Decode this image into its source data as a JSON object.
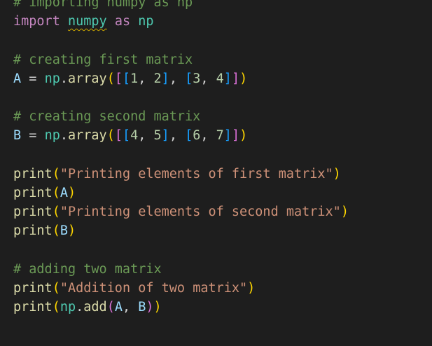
{
  "editor": {
    "language": "python",
    "colors": {
      "background": "#1e1e1e",
      "comment": "#6a9955",
      "keyword": "#c586c0",
      "module": "#4ec9b0",
      "variable": "#9cdcfe",
      "function": "#dcdcaa",
      "number": "#b5cea8",
      "string": "#ce9178",
      "bracket_level_1": "#ffd700",
      "bracket_level_2": "#da70d6",
      "bracket_level_3": "#179fff",
      "warning_squiggle": "#cca700"
    },
    "lines": [
      [
        {
          "t": "comment",
          "v": "# importing numpy as np"
        }
      ],
      [
        {
          "t": "keyword",
          "v": "import"
        },
        {
          "t": "op",
          "v": " "
        },
        {
          "t": "module",
          "v": "numpy",
          "squiggle": true
        },
        {
          "t": "op",
          "v": " "
        },
        {
          "t": "keyword",
          "v": "as"
        },
        {
          "t": "op",
          "v": " "
        },
        {
          "t": "module",
          "v": "np"
        }
      ],
      [],
      [
        {
          "t": "comment",
          "v": "# creating first matrix"
        }
      ],
      [
        {
          "t": "var",
          "v": "A"
        },
        {
          "t": "op",
          "v": " = "
        },
        {
          "t": "module",
          "v": "np"
        },
        {
          "t": "op",
          "v": "."
        },
        {
          "t": "func",
          "v": "array"
        },
        {
          "t": "br1",
          "v": "("
        },
        {
          "t": "br2",
          "v": "["
        },
        {
          "t": "br3",
          "v": "["
        },
        {
          "t": "number",
          "v": "1"
        },
        {
          "t": "op",
          "v": ", "
        },
        {
          "t": "number",
          "v": "2"
        },
        {
          "t": "br3",
          "v": "]"
        },
        {
          "t": "op",
          "v": ", "
        },
        {
          "t": "br3",
          "v": "["
        },
        {
          "t": "number",
          "v": "3"
        },
        {
          "t": "op",
          "v": ", "
        },
        {
          "t": "number",
          "v": "4"
        },
        {
          "t": "br3",
          "v": "]"
        },
        {
          "t": "br2",
          "v": "]"
        },
        {
          "t": "br1",
          "v": ")"
        }
      ],
      [],
      [
        {
          "t": "comment",
          "v": "# creating second matrix"
        }
      ],
      [
        {
          "t": "var",
          "v": "B"
        },
        {
          "t": "op",
          "v": " = "
        },
        {
          "t": "module",
          "v": "np"
        },
        {
          "t": "op",
          "v": "."
        },
        {
          "t": "func",
          "v": "array"
        },
        {
          "t": "br1",
          "v": "("
        },
        {
          "t": "br2",
          "v": "["
        },
        {
          "t": "br3",
          "v": "["
        },
        {
          "t": "number",
          "v": "4"
        },
        {
          "t": "op",
          "v": ", "
        },
        {
          "t": "number",
          "v": "5"
        },
        {
          "t": "br3",
          "v": "]"
        },
        {
          "t": "op",
          "v": ", "
        },
        {
          "t": "br3",
          "v": "["
        },
        {
          "t": "number",
          "v": "6"
        },
        {
          "t": "op",
          "v": ", "
        },
        {
          "t": "number",
          "v": "7"
        },
        {
          "t": "br3",
          "v": "]"
        },
        {
          "t": "br2",
          "v": "]"
        },
        {
          "t": "br1",
          "v": ")"
        }
      ],
      [],
      [
        {
          "t": "func",
          "v": "print"
        },
        {
          "t": "br1",
          "v": "("
        },
        {
          "t": "string",
          "v": "\"Printing elements of first matrix\""
        },
        {
          "t": "br1",
          "v": ")"
        }
      ],
      [
        {
          "t": "func",
          "v": "print"
        },
        {
          "t": "br1",
          "v": "("
        },
        {
          "t": "var",
          "v": "A"
        },
        {
          "t": "br1",
          "v": ")"
        }
      ],
      [
        {
          "t": "func",
          "v": "print"
        },
        {
          "t": "br1",
          "v": "("
        },
        {
          "t": "string",
          "v": "\"Printing elements of second matrix\""
        },
        {
          "t": "br1",
          "v": ")"
        }
      ],
      [
        {
          "t": "func",
          "v": "print"
        },
        {
          "t": "br1",
          "v": "("
        },
        {
          "t": "var",
          "v": "B"
        },
        {
          "t": "br1",
          "v": ")"
        }
      ],
      [],
      [
        {
          "t": "comment",
          "v": "# adding two matrix"
        }
      ],
      [
        {
          "t": "func",
          "v": "print"
        },
        {
          "t": "br1",
          "v": "("
        },
        {
          "t": "string",
          "v": "\"Addition of two matrix\""
        },
        {
          "t": "br1",
          "v": ")"
        }
      ],
      [
        {
          "t": "func",
          "v": "print"
        },
        {
          "t": "br1",
          "v": "("
        },
        {
          "t": "module",
          "v": "np"
        },
        {
          "t": "op",
          "v": "."
        },
        {
          "t": "func",
          "v": "add"
        },
        {
          "t": "br2",
          "v": "("
        },
        {
          "t": "var",
          "v": "A"
        },
        {
          "t": "op",
          "v": ", "
        },
        {
          "t": "var",
          "v": "B"
        },
        {
          "t": "br2",
          "v": ")"
        },
        {
          "t": "br1",
          "v": ")"
        }
      ]
    ]
  }
}
